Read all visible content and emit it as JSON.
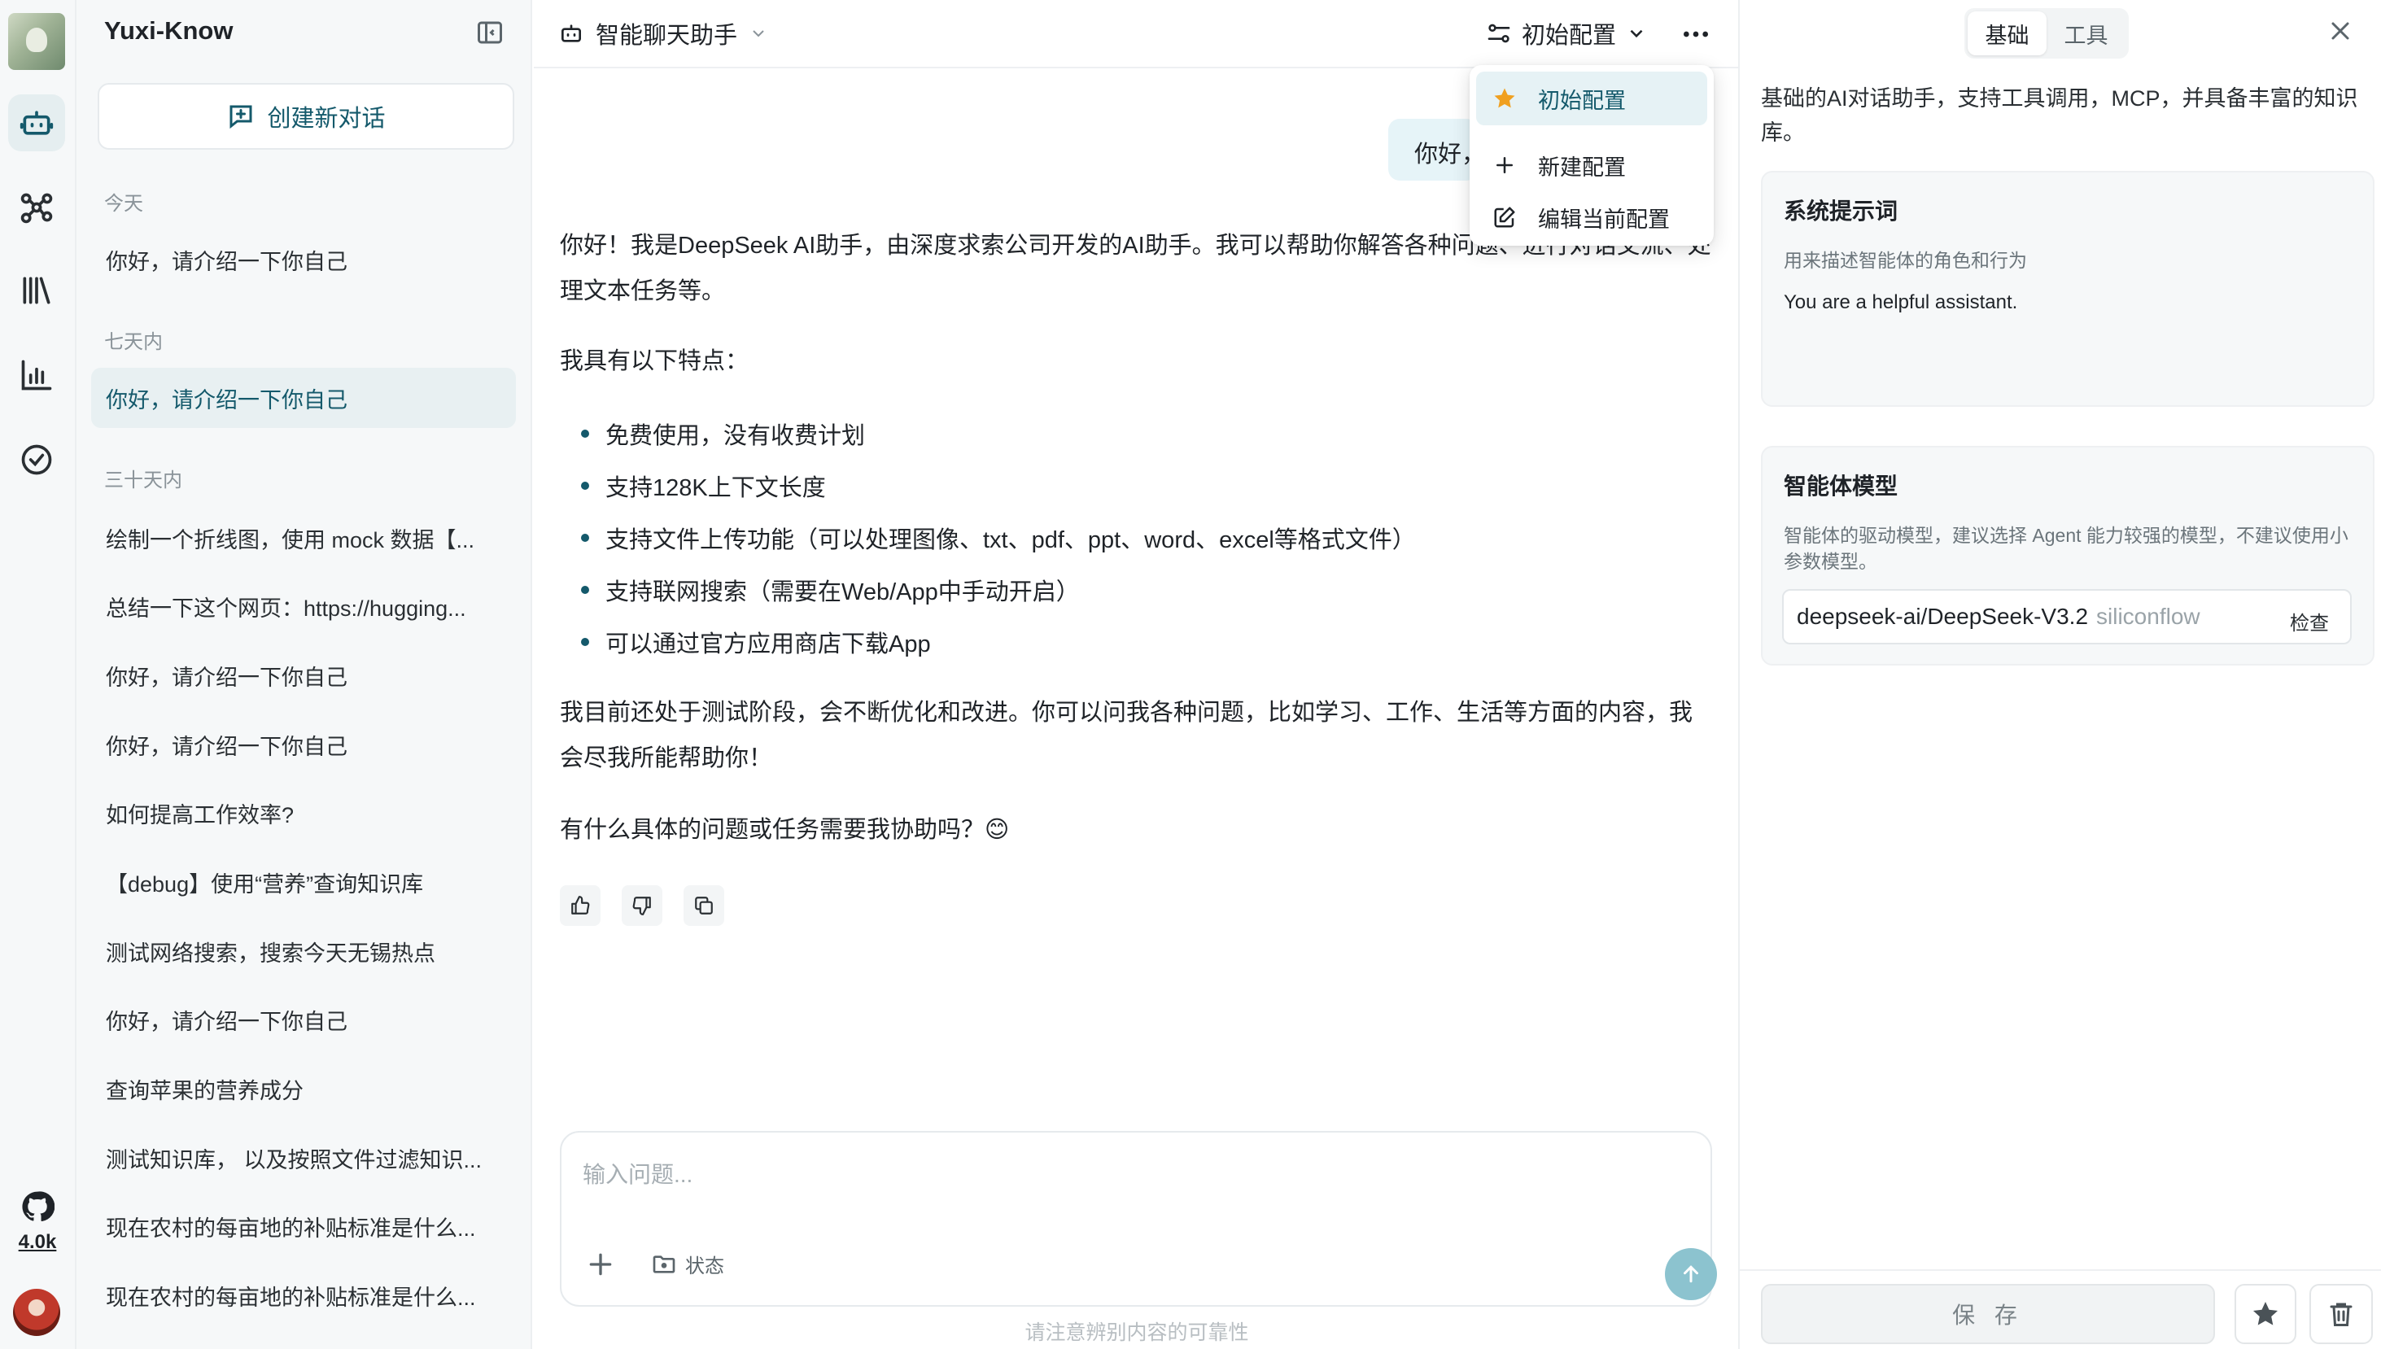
{
  "app": {
    "title": "Yuxi-Know",
    "github_stars": "4.0k"
  },
  "sidebar": {
    "new_chat_label": "创建新对话",
    "groups": [
      {
        "label": "今天",
        "items": [
          "你好，请介绍一下你自己"
        ]
      },
      {
        "label": "七天内",
        "items": [
          "你好，请介绍一下你自己"
        ]
      },
      {
        "label": "三十天内",
        "items": [
          "绘制一个折线图，使用 mock 数据【...",
          "总结一下这个网页：https://hugging...",
          "你好，请介绍一下你自己",
          "你好，请介绍一下你自己",
          "如何提高工作效率?",
          "【debug】使用“营养”查询知识库",
          "测试网络搜索，搜索今天无锡热点",
          "你好，请介绍一下你自己",
          "查询苹果的营养成分",
          "测试知识库， 以及按照文件过滤知识...",
          "现在农村的每亩地的补贴标准是什么...",
          "现在农村的每亩地的补贴标准是什么..."
        ]
      }
    ]
  },
  "header": {
    "agent_name": "智能聊天助手",
    "config_name": "初始配置"
  },
  "menu": {
    "items": [
      "初始配置",
      "新建配置",
      "编辑当前配置"
    ]
  },
  "chat": {
    "user_message": "你好，请介绍一下你自己",
    "answer_intro": "你好！我是DeepSeek AI助手，由深度求索公司开发的AI助手。我可以帮助你解答各种问题、进行对话交流、处理文本任务等。",
    "features_title": "我具有以下特点：",
    "features": [
      "免费使用，没有收费计划",
      "支持128K上下文长度",
      "支持文件上传功能（可以处理图像、txt、pdf、ppt、word、excel等格式文件）",
      "支持联网搜索（需要在Web/App中手动开启）",
      "可以通过官方应用商店下载App"
    ],
    "answer_body": "我目前还处于测试阶段，会不断优化和改进。你可以问我各种问题，比如学习、工作、生活等方面的内容，我会尽我所能帮助你！",
    "answer_end": "有什么具体的问题或任务需要我协助吗？😊"
  },
  "composer": {
    "placeholder": "输入问题...",
    "state_label": "状态",
    "disclaimer": "请注意辨别内容的可靠性"
  },
  "panel": {
    "tabs": [
      "基础",
      "工具"
    ],
    "description": "基础的AI对话助手，支持工具调用，MCP，并具备丰富的知识库。",
    "system_prompt": {
      "title": "系统提示词",
      "subtitle": "用来描述智能体的角色和行为",
      "value": "You are a helpful assistant."
    },
    "model": {
      "title": "智能体模型",
      "subtitle": "智能体的驱动模型，建议选择 Agent 能力较强的模型，不建议使用小参数模型。",
      "name": "deepseek-ai/DeepSeek-V3.2",
      "provider": "siliconflow",
      "check_label": "检查"
    },
    "save_label": "保 存"
  },
  "colors": {
    "accent": "#14596b",
    "send": "#8cc3cf",
    "star": "#f0a020"
  }
}
